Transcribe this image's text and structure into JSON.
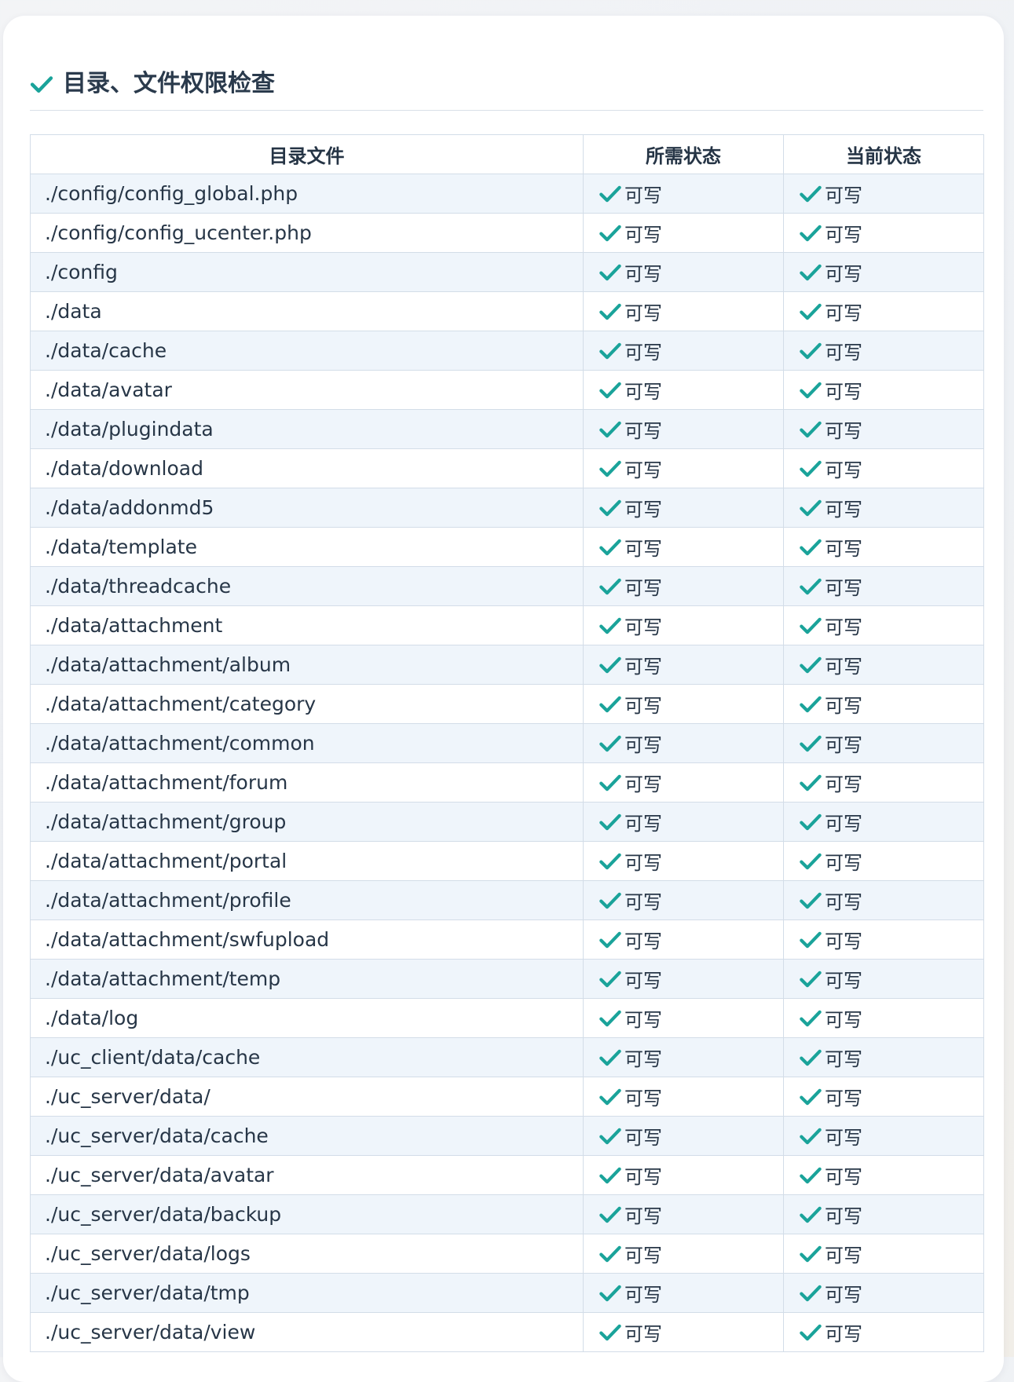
{
  "section": {
    "title": "目录、文件权限检查",
    "title_icon": "check-icon",
    "accent_color": "#1aa39a"
  },
  "table": {
    "headers": [
      "目录文件",
      "所需状态",
      "当前状态"
    ],
    "rows": [
      {
        "path": "./config/config_global.php",
        "required": "可写",
        "current": "可写"
      },
      {
        "path": "./config/config_ucenter.php",
        "required": "可写",
        "current": "可写"
      },
      {
        "path": "./config",
        "required": "可写",
        "current": "可写"
      },
      {
        "path": "./data",
        "required": "可写",
        "current": "可写"
      },
      {
        "path": "./data/cache",
        "required": "可写",
        "current": "可写"
      },
      {
        "path": "./data/avatar",
        "required": "可写",
        "current": "可写"
      },
      {
        "path": "./data/plugindata",
        "required": "可写",
        "current": "可写"
      },
      {
        "path": "./data/download",
        "required": "可写",
        "current": "可写"
      },
      {
        "path": "./data/addonmd5",
        "required": "可写",
        "current": "可写"
      },
      {
        "path": "./data/template",
        "required": "可写",
        "current": "可写"
      },
      {
        "path": "./data/threadcache",
        "required": "可写",
        "current": "可写"
      },
      {
        "path": "./data/attachment",
        "required": "可写",
        "current": "可写"
      },
      {
        "path": "./data/attachment/album",
        "required": "可写",
        "current": "可写"
      },
      {
        "path": "./data/attachment/category",
        "required": "可写",
        "current": "可写"
      },
      {
        "path": "./data/attachment/common",
        "required": "可写",
        "current": "可写"
      },
      {
        "path": "./data/attachment/forum",
        "required": "可写",
        "current": "可写"
      },
      {
        "path": "./data/attachment/group",
        "required": "可写",
        "current": "可写"
      },
      {
        "path": "./data/attachment/portal",
        "required": "可写",
        "current": "可写"
      },
      {
        "path": "./data/attachment/profile",
        "required": "可写",
        "current": "可写"
      },
      {
        "path": "./data/attachment/swfupload",
        "required": "可写",
        "current": "可写"
      },
      {
        "path": "./data/attachment/temp",
        "required": "可写",
        "current": "可写"
      },
      {
        "path": "./data/log",
        "required": "可写",
        "current": "可写"
      },
      {
        "path": "./uc_client/data/cache",
        "required": "可写",
        "current": "可写"
      },
      {
        "path": "./uc_server/data/",
        "required": "可写",
        "current": "可写"
      },
      {
        "path": "./uc_server/data/cache",
        "required": "可写",
        "current": "可写"
      },
      {
        "path": "./uc_server/data/avatar",
        "required": "可写",
        "current": "可写"
      },
      {
        "path": "./uc_server/data/backup",
        "required": "可写",
        "current": "可写"
      },
      {
        "path": "./uc_server/data/logs",
        "required": "可写",
        "current": "可写"
      },
      {
        "path": "./uc_server/data/tmp",
        "required": "可写",
        "current": "可写"
      },
      {
        "path": "./uc_server/data/view",
        "required": "可写",
        "current": "可写"
      }
    ]
  }
}
